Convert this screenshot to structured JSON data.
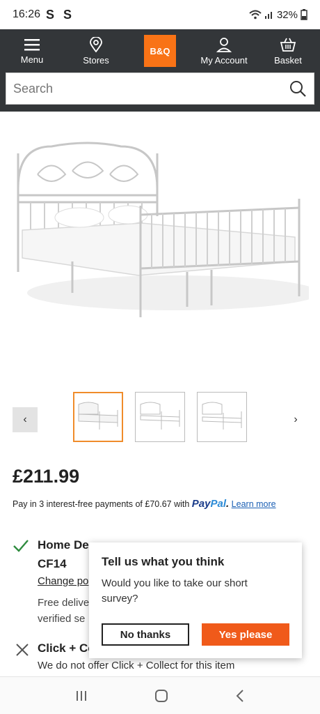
{
  "status_bar": {
    "time": "16:26",
    "indicators": "S S",
    "battery": "32%"
  },
  "nav": {
    "menu_label": "Menu",
    "stores_label": "Stores",
    "logo_text": "B&Q",
    "account_label": "My Account",
    "basket_label": "Basket"
  },
  "search": {
    "placeholder": "Search"
  },
  "product": {
    "price": "£211.99",
    "paypal_text": "Pay in 3 interest-free payments of £70.67 with",
    "paypal_pay": "Pay",
    "paypal_pal": "Pal",
    "learn_more": "Learn more",
    "gallery_count": 3,
    "active_thumb": 1
  },
  "delivery": {
    "home_title": "Home De",
    "postcode": "CF14",
    "change_postcode": "Change po",
    "free_delivery": "Free delive",
    "verified": "verified se",
    "cc_title": "Click + Co",
    "cc_note": "We do not offer Click + Collect for this item"
  },
  "survey": {
    "title": "Tell us what you think",
    "text": "Would you like to take our short survey?",
    "no_label": "No thanks",
    "yes_label": "Yes please"
  },
  "colors": {
    "nav_bg": "#333639",
    "brand": "#f97316",
    "accent_button": "#f05a1a",
    "check": "#2e8b3e"
  }
}
